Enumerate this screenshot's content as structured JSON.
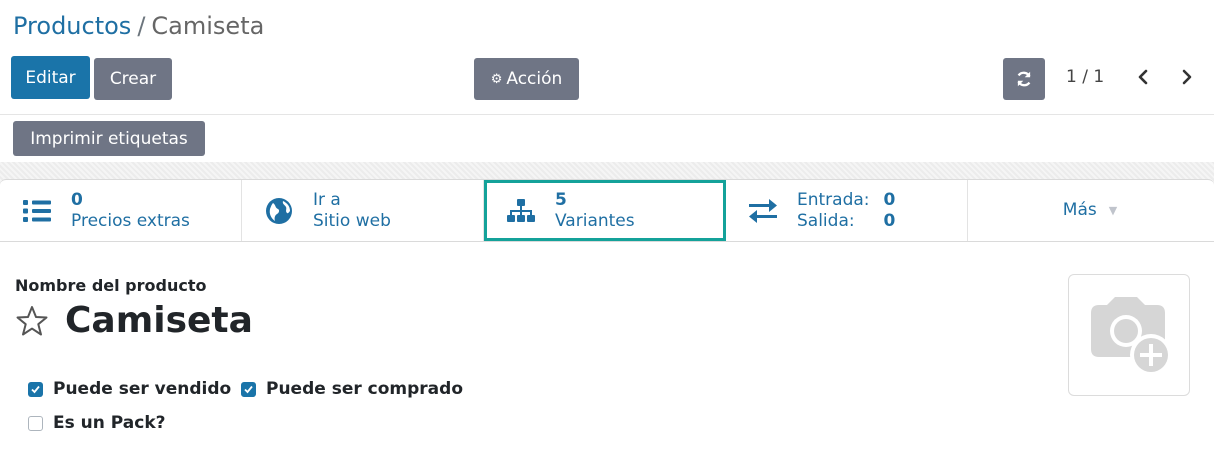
{
  "breadcrumb": {
    "parent": "Productos",
    "separator": "/",
    "current": "Camiseta"
  },
  "toolbar": {
    "edit_label": "Editar",
    "create_label": "Crear",
    "action_label": "Acción",
    "print_labels_label": "Imprimir etiquetas",
    "pager": "1 / 1"
  },
  "smart_buttons": {
    "extra_prices": {
      "value": "0",
      "label": "Precios extras"
    },
    "website": {
      "line1": "Ir a",
      "line2": "Sitio web"
    },
    "variants": {
      "value": "5",
      "label": "Variantes"
    },
    "moves": {
      "in_label": "Entrada:",
      "in_value": "0",
      "out_label": "Salida:",
      "out_value": "0"
    },
    "more": {
      "label": "Más"
    }
  },
  "product": {
    "name_label": "Nombre del producto",
    "name": "Camiseta"
  },
  "checkboxes": {
    "sale_ok": {
      "label": "Puede ser vendido",
      "checked": true
    },
    "purchase_ok": {
      "label": "Puede ser comprado",
      "checked": true
    },
    "is_pack": {
      "label": "Es un Pack?",
      "checked": false
    }
  },
  "icons": [
    "gear-icon",
    "refresh-icon",
    "chevron-left-icon",
    "chevron-right-icon",
    "list-icon",
    "globe-icon",
    "sitemap-icon",
    "exchange-icon",
    "caret-down-icon",
    "star-icon",
    "check-icon",
    "camera-plus-icon"
  ],
  "colors": {
    "primary": "#1a74a9",
    "secondary": "#6f7585",
    "link": "#1f6fa3",
    "highlight": "#14a29a"
  }
}
